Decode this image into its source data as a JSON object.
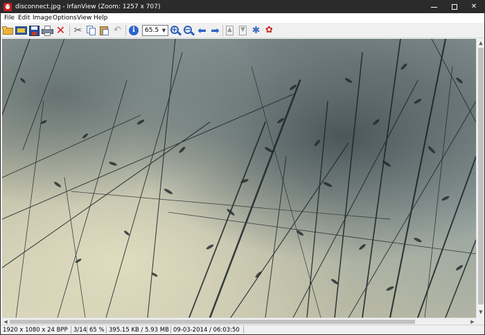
{
  "window": {
    "title": "disconnect.jpg - IrfanView (Zoom: 1257 x 707)",
    "app_icon": "irfanview-cat-icon",
    "controls": {
      "minimize": "minimize-icon",
      "maximize": "maximize-icon",
      "close": "✕"
    }
  },
  "menu": {
    "items": [
      "File",
      "Edit",
      "Image",
      "Options",
      "View",
      "Help"
    ]
  },
  "toolbar": {
    "icons": [
      "open-folder-icon",
      "slideshow-icon",
      "save-icon",
      "print-icon",
      "delete-icon",
      "cut-icon",
      "copy-icon",
      "paste-icon",
      "undo-icon",
      "info-icon",
      "zoom-in-icon",
      "zoom-out-icon",
      "previous-arrow-icon",
      "next-arrow-icon",
      "first-page-icon",
      "last-page-icon",
      "settings-icon",
      "about-icon"
    ],
    "zoom_value": "65.5"
  },
  "image": {
    "description_icon": "grass-photo",
    "colors": {
      "sky_light": "#d4d2b6",
      "sky_mid": "#9aa6a2",
      "sky_dark": "#4f5b5d",
      "stems": "#1d2428"
    }
  },
  "scroll": {
    "horizontal_position": 0.0,
    "vertical_position": 0.0
  },
  "status": {
    "dimensions": "1920 x 1080 x 24 BPP",
    "index": "3/14",
    "zoom": "65 %",
    "file_size": "395.15 KB / 5.93 MB",
    "datetime": "09-03-2014 / 06:03:50"
  }
}
